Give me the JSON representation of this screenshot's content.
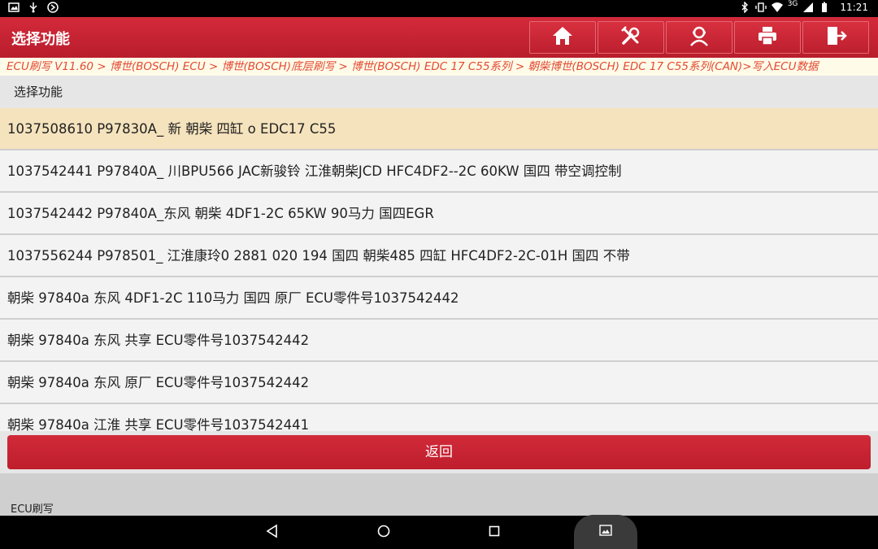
{
  "status_bar": {
    "network": "3G",
    "time": "11:21",
    "icons": [
      "gallery-icon",
      "usb-icon",
      "vpn-icon",
      "bluetooth-icon",
      "vibrate-icon",
      "wifi-icon",
      "signal-icon",
      "battery-icon"
    ]
  },
  "header": {
    "title": "选择功能",
    "toolbar_icons": [
      "home-icon",
      "tools-icon",
      "user-icon",
      "print-icon",
      "exit-icon"
    ]
  },
  "breadcrumb": "ECU刷写 V11.60 > 博世(BOSCH) ECU > 博世(BOSCH)底层刷写 > 博世(BOSCH) EDC 17 C55系列 > 朝柴博世(BOSCH) EDC 17 C55系列(CAN)>写入ECU数据",
  "section": {
    "title": "选择功能"
  },
  "items": [
    {
      "label": "1037508610 P97830A_ 新 朝柴  四缸 o EDC17 C55"
    },
    {
      "label": "1037542441 P97840A_ 川BPU566 JAC新骏铃 江淮朝柴JCD HFC4DF2--2C 60KW 国四 带空调控制"
    },
    {
      "label": "1037542442 P97840A_东风 朝柴 4DF1-2C 65KW  90马力 国四EGR"
    },
    {
      "label": "1037556244 P978501_ 江淮康玲0 2881 020 194 国四 朝柴485 四缸 HFC4DF2-2C-01H 国四 不带"
    },
    {
      "label": "朝柴 97840a 东风 4DF1-2C 110马力 国四 原厂 ECU零件号1037542442"
    },
    {
      "label": "朝柴 97840a 东风 共享 ECU零件号1037542442"
    },
    {
      "label": "朝柴 97840a 东风 原厂 ECU零件号1037542442"
    },
    {
      "label": "朝柴 97840a 江淮 共享 ECU零件号1037542441"
    }
  ],
  "buttons": {
    "back": "返回"
  },
  "footer": {
    "label": "ECU刷写"
  },
  "colors": {
    "brand_red": "#c62332",
    "breadcrumb_text": "#e34a32",
    "selected_row": "#f5e3bd"
  }
}
